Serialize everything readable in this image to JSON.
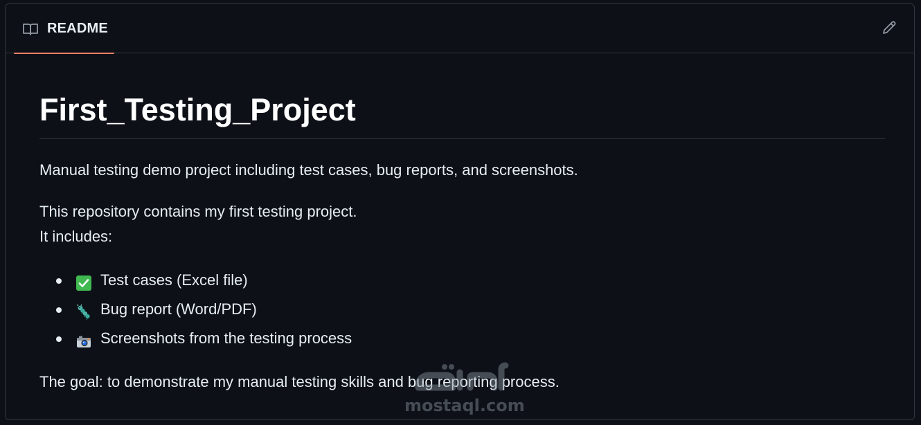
{
  "header": {
    "tab_label": "README",
    "tab_icon": "book-icon",
    "edit_icon": "pencil-icon"
  },
  "readme": {
    "title": "First_Testing_Project",
    "description": "Manual testing demo project including test cases, bug reports, and screenshots.",
    "intro_line1": "This repository contains my first testing project.",
    "intro_line2": "It includes:",
    "items": [
      {
        "icon": "check-box-icon",
        "text": "Test cases (Excel file)"
      },
      {
        "icon": "bug-icon",
        "text": "Bug report (Word/PDF)"
      },
      {
        "icon": "camera-icon",
        "text": "Screenshots from the testing process"
      }
    ],
    "goal": "The goal: to demonstrate my manual testing skills and bug reporting process."
  },
  "watermark": {
    "arabic": "مستقل",
    "text": "mostaql.com"
  },
  "colors": {
    "background": "#0d1117",
    "border": "#30363d",
    "text": "#e6edf3",
    "tab_underline": "#f78166",
    "check_green": "#3fb950"
  }
}
